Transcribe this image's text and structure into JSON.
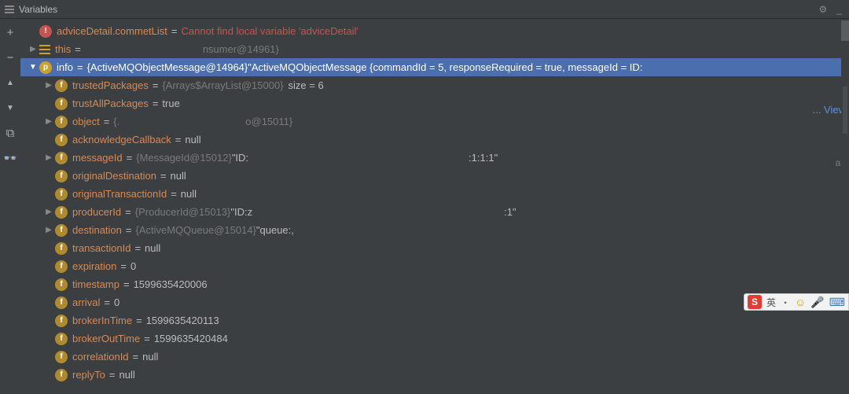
{
  "panel": {
    "title": "Variables"
  },
  "toolbar": {
    "add": "+",
    "remove": "−",
    "up": "▲",
    "down": "▼",
    "copy": "⧉",
    "glasses": "👓"
  },
  "header_buttons": {
    "settings": "⚙",
    "minimize": "_"
  },
  "view_link": "... View",
  "right_hint": "ad",
  "rows": [
    {
      "depth": 0,
      "arrow": "",
      "badge": "!",
      "badge_cls": "badge-red",
      "name": "adviceDetail.commetList",
      "eq": "=",
      "value": "Cannot find local variable 'adviceDetail'",
      "val_cls": "val-err"
    },
    {
      "depth": 0,
      "arrow": "▶",
      "stack": true,
      "name": "this",
      "eq": "=",
      "obj": "",
      "tail": "nsumer@14961}"
    },
    {
      "depth": 0,
      "arrow": "▼",
      "badge": "p",
      "badge_cls": "badge-gold",
      "name": "info",
      "eq": "=",
      "obj": "{ActiveMQObjectMessage@14964}",
      "str": " \"ActiveMQObjectMessage {commandId = 5, responseRequired = true, messageId = ID:",
      "selected": true
    },
    {
      "depth": 1,
      "arrow": "▶",
      "badge": "f",
      "badge_cls": "badge-orange",
      "name": "trustedPackages",
      "eq": "=",
      "obj": "{Arrays$ArrayList@15000}",
      "size": "size = 6"
    },
    {
      "depth": 1,
      "arrow": "",
      "badge": "f",
      "badge_cls": "badge-orange",
      "name": "trustAllPackages",
      "eq": "=",
      "str": "true"
    },
    {
      "depth": 1,
      "arrow": "▶",
      "badge": "f",
      "badge_cls": "badge-orange",
      "name": "object",
      "eq": "=",
      "obj": "{.",
      "tail": "o@15011}"
    },
    {
      "depth": 1,
      "arrow": "",
      "badge": "f",
      "badge_cls": "badge-orange",
      "name": "acknowledgeCallback",
      "eq": "=",
      "str": "null"
    },
    {
      "depth": 1,
      "arrow": "▶",
      "badge": "f",
      "badge_cls": "badge-orange",
      "name": "messageId",
      "eq": "=",
      "obj": "{MessageId@15012}",
      "str": " \"ID:",
      "tail": ":1:1:1\""
    },
    {
      "depth": 1,
      "arrow": "",
      "badge": "f",
      "badge_cls": "badge-orange",
      "name": "originalDestination",
      "eq": "=",
      "str": "null"
    },
    {
      "depth": 1,
      "arrow": "",
      "badge": "f",
      "badge_cls": "badge-orange",
      "name": "originalTransactionId",
      "eq": "=",
      "str": "null"
    },
    {
      "depth": 1,
      "arrow": "▶",
      "badge": "f",
      "badge_cls": "badge-orange",
      "name": "producerId",
      "eq": "=",
      "obj": "{ProducerId@15013}",
      "str": " \"ID:z",
      "tail": ":1\""
    },
    {
      "depth": 1,
      "arrow": "▶",
      "badge": "f",
      "badge_cls": "badge-orange",
      "name": "destination",
      "eq": "=",
      "obj": "{ActiveMQQueue@15014}",
      "str": " \"queue:,"
    },
    {
      "depth": 1,
      "arrow": "",
      "badge": "f",
      "badge_cls": "badge-orange",
      "name": "transactionId",
      "eq": "=",
      "str": "null"
    },
    {
      "depth": 1,
      "arrow": "",
      "badge": "f",
      "badge_cls": "badge-orange",
      "name": "expiration",
      "eq": "=",
      "str": "0"
    },
    {
      "depth": 1,
      "arrow": "",
      "badge": "f",
      "badge_cls": "badge-orange",
      "name": "timestamp",
      "eq": "=",
      "str": "1599635420006"
    },
    {
      "depth": 1,
      "arrow": "",
      "badge": "f",
      "badge_cls": "badge-orange",
      "name": "arrival",
      "eq": "=",
      "str": "0"
    },
    {
      "depth": 1,
      "arrow": "",
      "badge": "f",
      "badge_cls": "badge-orange",
      "name": "brokerInTime",
      "eq": "=",
      "str": "1599635420113"
    },
    {
      "depth": 1,
      "arrow": "",
      "badge": "f",
      "badge_cls": "badge-orange",
      "name": "brokerOutTime",
      "eq": "=",
      "str": "1599635420484"
    },
    {
      "depth": 1,
      "arrow": "",
      "badge": "f",
      "badge_cls": "badge-orange",
      "name": "correlationId",
      "eq": "=",
      "str": "null"
    },
    {
      "depth": 1,
      "arrow": "",
      "badge": "f",
      "badge_cls": "badge-orange",
      "name": "replyTo",
      "eq": "=",
      "str": "null"
    }
  ],
  "ime": {
    "logo": "S",
    "lang": "英",
    "dot": "・",
    "smile": "☺",
    "mic": "🎤",
    "kbd": "⌨"
  }
}
